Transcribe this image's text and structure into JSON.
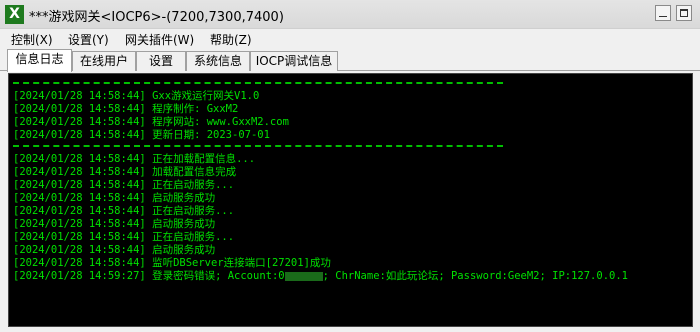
{
  "window": {
    "title": "***游戏网关<IOCP6>-(7200,7300,7400)",
    "icon_glyph": "X"
  },
  "menu": [
    "控制(X)",
    "设置(Y)",
    "网关插件(W)",
    "帮助(Z)"
  ],
  "tabs": [
    "信息日志",
    "在线用户",
    "设置",
    "系统信息",
    "IOCP调试信息"
  ],
  "active_tab": 0,
  "log": {
    "color": "#00e000",
    "header": [
      "[2024/01/28 14:58:44] Gxx游戏运行网关V1.0",
      "[2024/01/28 14:58:44] 程序制作: GxxM2",
      "[2024/01/28 14:58:44] 程序网站: www.GxxM2.com",
      "[2024/01/28 14:58:44] 更新日期: 2023-07-01"
    ],
    "entries": [
      "[2024/01/28 14:58:44] 正在加载配置信息...",
      "[2024/01/28 14:58:44] 加载配置信息完成",
      "[2024/01/28 14:58:44] 正在启动服务...",
      "[2024/01/28 14:58:44] 启动服务成功",
      "[2024/01/28 14:58:44] 正在启动服务...",
      "[2024/01/28 14:58:44] 启动服务成功",
      "[2024/01/28 14:58:44] 正在启动服务...",
      "[2024/01/28 14:58:44] 启动服务成功",
      "[2024/01/28 14:58:44] 监听DBServer连接端口[27201]成功"
    ],
    "last_prefix": "[2024/01/28 14:59:27] 登录密码错误; Account:",
    "last_masked_char": "0",
    "last_suffix": "; ChrName:如此玩论坛; Password:GeeM2; IP:127.0.0.1"
  }
}
